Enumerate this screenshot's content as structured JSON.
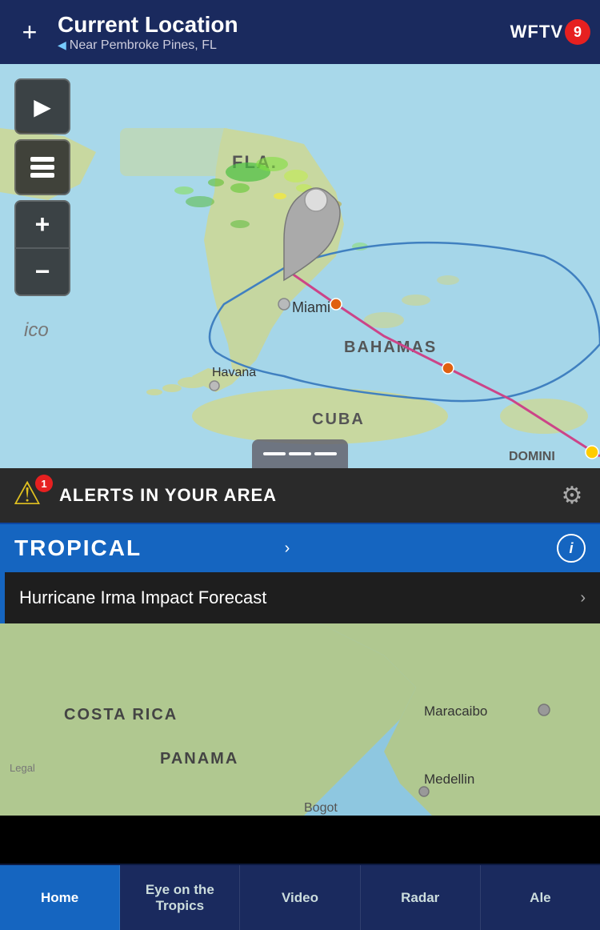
{
  "header": {
    "add_label": "+",
    "title": "Current Location",
    "subtitle": "Near Pembroke Pines, FL",
    "logo_text": "WFTV",
    "logo_number": "9"
  },
  "map": {
    "play_icon": "▶",
    "zoom_in": "+",
    "zoom_out": "−"
  },
  "alerts": {
    "count": "1",
    "text": "ALERTS IN YOUR AREA"
  },
  "tropical": {
    "label": "TROPICAL",
    "chevron": "›",
    "info": "i"
  },
  "hurricane_row": {
    "text": "Hurricane Irma Impact Forecast",
    "chevron": "›"
  },
  "tabs": [
    {
      "label": "Home",
      "active": true
    },
    {
      "label": "Eye on the Tropics",
      "active": false
    },
    {
      "label": "Video",
      "active": false
    },
    {
      "label": "Radar",
      "active": false
    },
    {
      "label": "Ale",
      "active": false
    }
  ]
}
